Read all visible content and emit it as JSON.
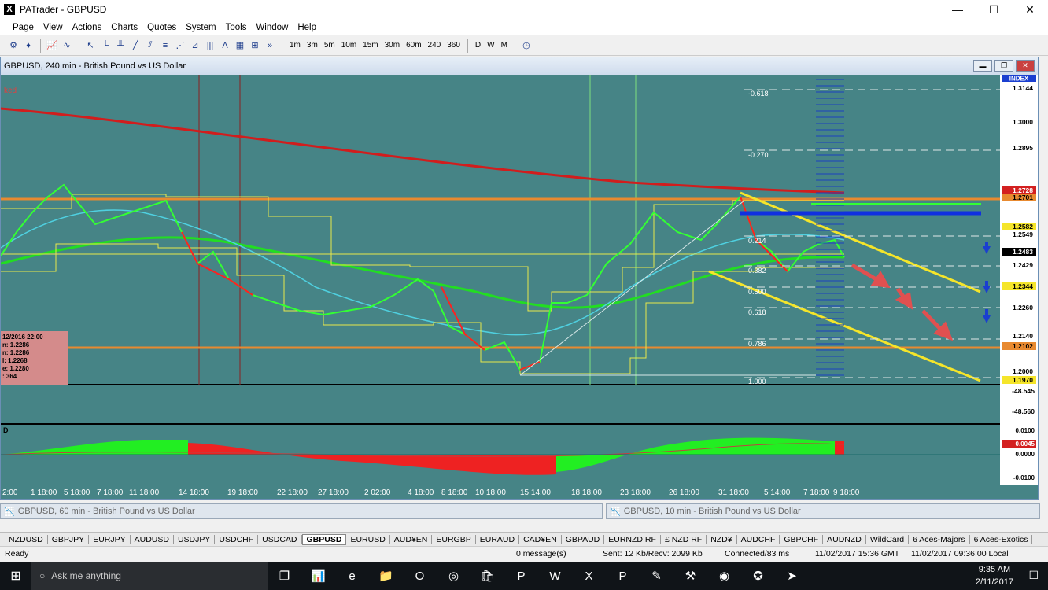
{
  "window": {
    "title": "PATrader - GBPUSD",
    "icon": "X",
    "minimize": "—",
    "maximize": "☐",
    "close": "✕"
  },
  "menu": [
    "Page",
    "View",
    "Actions",
    "Charts",
    "Quotes",
    "System",
    "Tools",
    "Window",
    "Help"
  ],
  "toolbar": {
    "timeframes": [
      "1m",
      "3m",
      "5m",
      "10m",
      "15m",
      "30m",
      "60m",
      "240",
      "360"
    ],
    "periods": [
      "D",
      "W",
      "M"
    ],
    "more": "»"
  },
  "chart": {
    "title": "GBPUSD, 240 min - British Pound vs US Dollar",
    "corner_label": "ked",
    "index_label": "INDEX",
    "price_labels": [
      "1.3144",
      "1.3000",
      "1.2895",
      "1.2728",
      "1.2701",
      "1.2582",
      "1.2549",
      "1.2483",
      "1.2429",
      "1.2344",
      "1.2260",
      "1.2140",
      "1.2102",
      "1.2000",
      "1.1970"
    ],
    "lower_labels": [
      "-48.545",
      "-48.560"
    ],
    "fib_labels": [
      "-0.618",
      "-0.270",
      "0.214",
      "0.382",
      "0.500",
      "0.618",
      "0.786",
      "1.000"
    ],
    "data_box": [
      "12/2016 22:00",
      "n: 1.2286",
      "n: 1.2286",
      "l: 1.2268",
      "e: 1.2280",
      ": 364"
    ],
    "osc_labels": [
      "0.0100",
      "0.0045",
      "0.0000",
      "-0.0100"
    ],
    "osc_title": "D",
    "time_labels": [
      "2:00",
      "1 18:00",
      "5 18:00",
      "7 18:00",
      "11 18:00",
      "14 18:00",
      "19 18:00",
      "22 18:00",
      "27 18:00",
      "2 02:00",
      "4 18:00",
      "8 18:00",
      "10 18:00",
      "15 14:00",
      "18 18:00",
      "23 18:00",
      "26 18:00",
      "31 18:00",
      "5 14:00",
      "7 18:00",
      "9 18:00"
    ]
  },
  "subwindows": [
    {
      "title": "GBPUSD, 60 min - British Pound vs US Dollar"
    },
    {
      "title": "GBPUSD, 10 min - British Pound vs US Dollar"
    }
  ],
  "tabs": [
    "NZDUSD",
    "GBPJPY",
    "EURJPY",
    "AUDUSD",
    "USDJPY",
    "USDCHF",
    "USDCAD",
    "GBPUSD",
    "EURUSD",
    "AUD¥EN",
    "EURGBP",
    "EURAUD",
    "CAD¥EN",
    "GBPAUD",
    "EURNZD RF",
    "£ NZD RF",
    "NZD¥",
    "AUDCHF",
    "GBPCHF",
    "AUDNZD",
    "WildCard",
    "6 Aces-Majors",
    "6 Aces-Exotics"
  ],
  "active_tab": "GBPUSD",
  "status": {
    "ready": "Ready",
    "messages": "0 message(s)",
    "sent": "Sent: 12 Kb/Recv: 2099 Kb",
    "connected": "Connected/83 ms",
    "gmt": "11/02/2017 15:36 GMT",
    "local": "11/02/2017 09:36:00 Local"
  },
  "taskbar": {
    "search_placeholder": "Ask me anything",
    "time": "9:35 AM",
    "date": "2/11/2017"
  }
}
